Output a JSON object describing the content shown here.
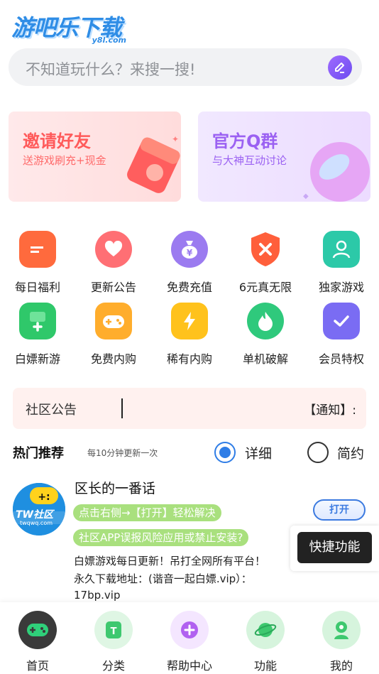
{
  "header": {
    "logo_text": "游吧乐下载",
    "logo_domain": "y8l.com",
    "search_placeholder": "不知道玩什么？来搜一搜!"
  },
  "banners": {
    "invite": {
      "title": "邀请好友",
      "subtitle": "送游戏刷充+现金"
    },
    "qq": {
      "title": "官方Q群",
      "subtitle": "与大神互动讨论"
    }
  },
  "grid": [
    {
      "label": "每日福利",
      "icon": "folder-icon",
      "color": "#ff6a3d"
    },
    {
      "label": "更新公告",
      "icon": "heart-icon",
      "color": "#ff6f74"
    },
    {
      "label": "免费充值",
      "icon": "money-bag-icon",
      "color": "#9b7bf0"
    },
    {
      "label": "6元真无限",
      "icon": "shield-icon",
      "color": "#ff5f3b"
    },
    {
      "label": "独家游戏",
      "icon": "user-icon",
      "color": "#2cc9a8"
    },
    {
      "label": "白嫖新游",
      "icon": "phone-plus-icon",
      "color": "#2fc86a"
    },
    {
      "label": "免费内购",
      "icon": "gamepad-icon",
      "color": "#ffad2c"
    },
    {
      "label": "稀有内购",
      "icon": "lightning-icon",
      "color": "#ffc21c"
    },
    {
      "label": "单机破解",
      "icon": "flame-icon",
      "color": "#2fc97c"
    },
    {
      "label": "会员特权",
      "icon": "check-icon",
      "color": "#7a6cf3"
    }
  ],
  "notice": {
    "title": "社区公告",
    "message": "【通知】:"
  },
  "hot": {
    "title": "热门推荐",
    "subtitle": "每10分钟更新一次",
    "option_detail": "详细",
    "option_brief": "简约",
    "selected": "详细"
  },
  "item": {
    "title": "区长的一番话",
    "avatar_text": "TW社区",
    "avatar_sub": "twqwq.com",
    "tag1": "点击右侧→【打开】轻松解决",
    "tag2": "社区APP误报风险应用或禁止安装?",
    "open_label": "打开",
    "desc1": "白嫖游戏每日更新！吊打全网所有平台！",
    "desc2": "永久下载地址：(谐音一起白嫖.vip）：",
    "desc3": "17bp.vip"
  },
  "quick": {
    "label": "快捷功能"
  },
  "nav": [
    {
      "label": "首页",
      "icon": "gamepad-icon",
      "color": "#3a3a3a"
    },
    {
      "label": "分类",
      "icon": "category-icon",
      "color": "#bfeec8"
    },
    {
      "label": "帮助中心",
      "icon": "plus-icon",
      "color": "#f2e2ff"
    },
    {
      "label": "功能",
      "icon": "planet-icon",
      "color": "#c4f0cf"
    },
    {
      "label": "我的",
      "icon": "profile-icon",
      "color": "#c4f0cf"
    }
  ]
}
